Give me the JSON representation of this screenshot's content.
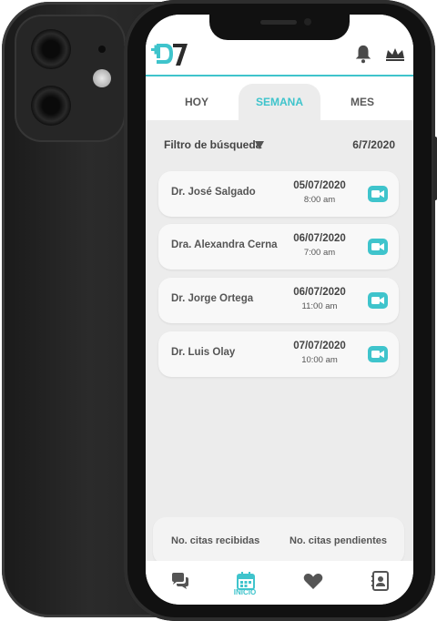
{
  "app": {
    "brand": "DF7"
  },
  "colors": {
    "accent": "#3fc4cc",
    "text": "#555555",
    "panel": "#ececec"
  },
  "header": {
    "icons": [
      "bell-icon",
      "crown-icon"
    ]
  },
  "tabs": [
    {
      "label": "HOY",
      "active": false
    },
    {
      "label": "SEMANA",
      "active": true
    },
    {
      "label": "MES",
      "active": false
    }
  ],
  "filter": {
    "label": "Filtro de búsqueda",
    "date": "6/7/2020"
  },
  "appointments": [
    {
      "doctor": "Dr. José Salgado",
      "date": "05/07/2020",
      "time": "8:00 am"
    },
    {
      "doctor": "Dra. Alexandra Cerna",
      "date": "06/07/2020",
      "time": "7:00 am"
    },
    {
      "doctor": "Dr. Jorge Ortega",
      "date": "06/07/2020",
      "time": "11:00 am"
    },
    {
      "doctor": "Dr. Luis Olay",
      "date": "07/07/2020",
      "time": "10:00 am"
    }
  ],
  "stats": {
    "received": "No. citas recibidas",
    "pending": "No. citas pendientes"
  },
  "nav": {
    "home_label": "INICIO",
    "items": [
      "chat-icon",
      "calendar-icon",
      "heart-icon",
      "contacts-icon"
    ]
  }
}
